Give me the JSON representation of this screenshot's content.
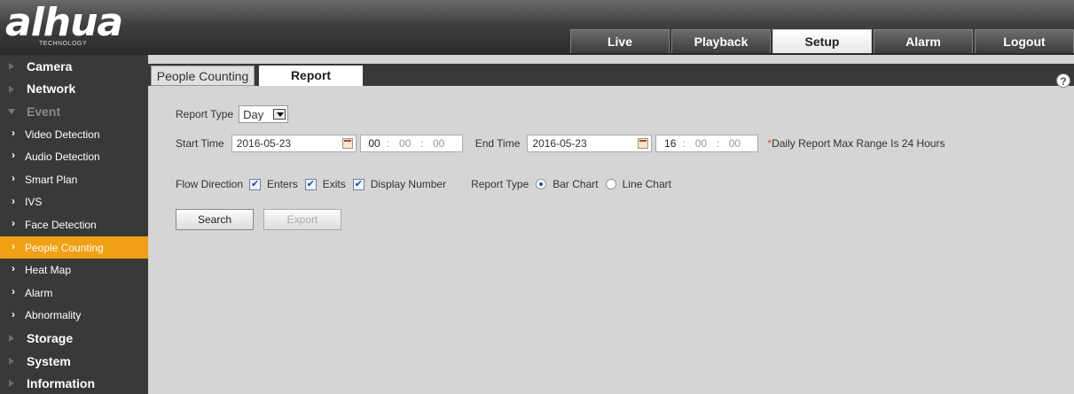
{
  "brand": {
    "logo_text": "alhua",
    "logo_sub": "TECHNOLOGY"
  },
  "topnav": [
    "Live",
    "Playback",
    "Setup",
    "Alarm",
    "Logout"
  ],
  "topnav_active": "Setup",
  "sidebar": {
    "groups_top": [
      "Camera",
      "Network"
    ],
    "open_group": "Event",
    "event_items": [
      "Video Detection",
      "Audio Detection",
      "Smart Plan",
      "IVS",
      "Face Detection",
      "People Counting",
      "Heat Map",
      "Alarm",
      "Abnormality"
    ],
    "active_item": "People Counting",
    "groups_bottom": [
      "Storage",
      "System",
      "Information"
    ]
  },
  "subtabs": {
    "people_counting": "People Counting",
    "report": "Report"
  },
  "help_icon_glyph": "?",
  "form": {
    "report_type_label": "Report Type",
    "report_type_value": "Day",
    "start_time_label": "Start Time",
    "start_date": "2016-05-23",
    "start_hh": "00",
    "start_mm": "00",
    "start_ss": "00",
    "end_time_label": "End Time",
    "end_date": "2016-05-23",
    "end_hh": "16",
    "end_mm": "00",
    "end_ss": "00",
    "note_star": "*",
    "note_text": "Daily Report Max Range Is 24 Hours",
    "flow_direction_label": "Flow Direction",
    "enters_label": "Enters",
    "exits_label": "Exits",
    "display_number_label": "Display Number",
    "report_type2_label": "Report Type",
    "bar_chart_label": "Bar Chart",
    "line_chart_label": "Line Chart",
    "time_sep": ":"
  },
  "buttons": {
    "search": "Search",
    "export": "Export"
  },
  "colors": {
    "active_orange": "#f0a014",
    "header_dark": "#3f3f3f"
  }
}
